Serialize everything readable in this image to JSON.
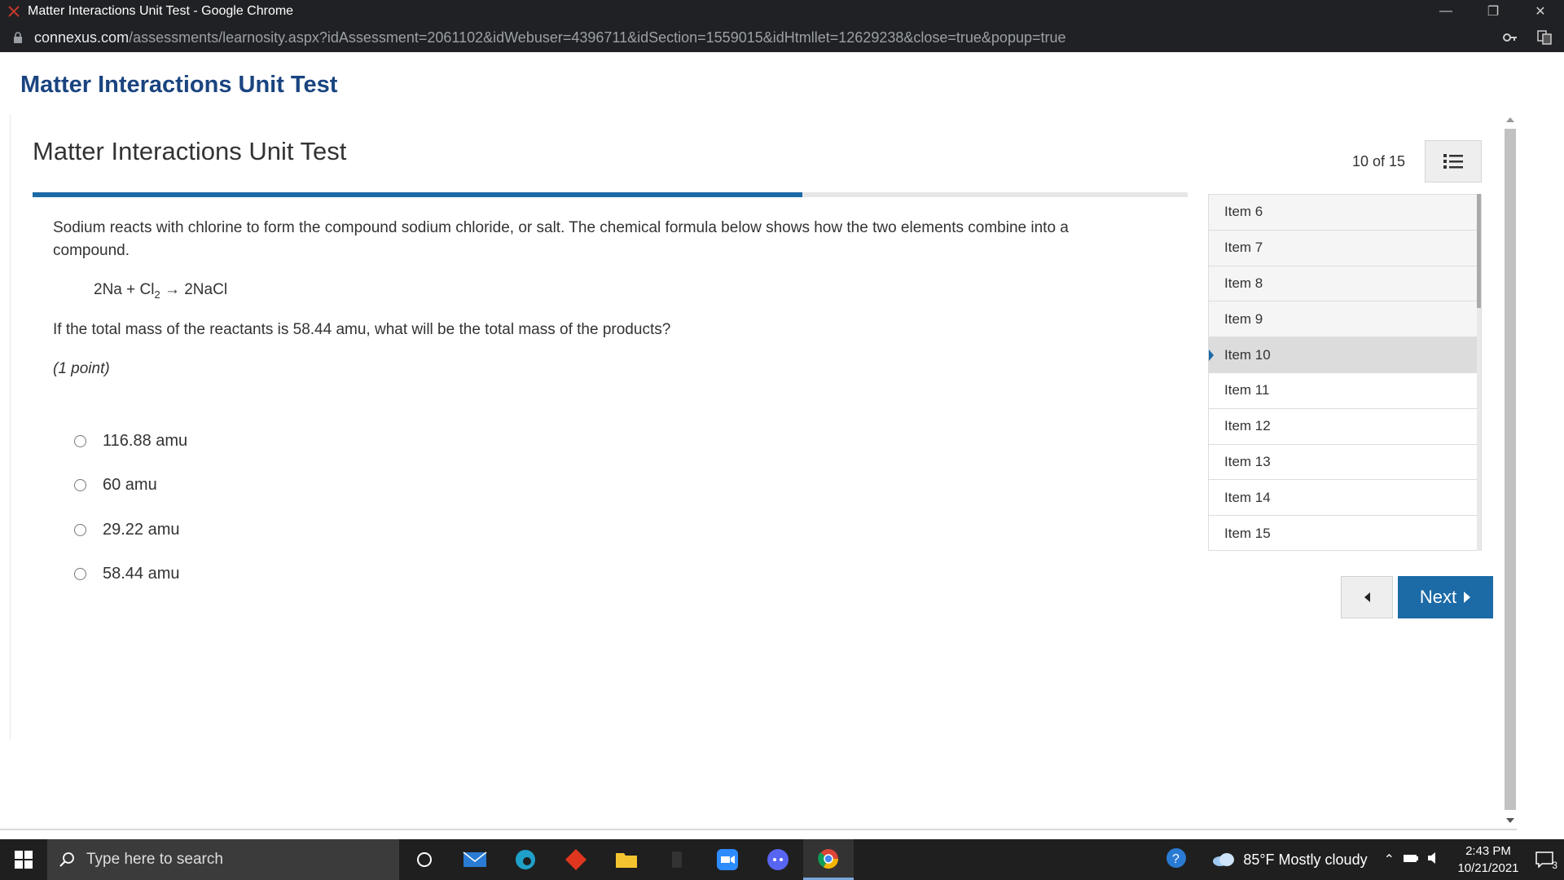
{
  "browser": {
    "window_title": "Matter Interactions Unit Test - Google Chrome",
    "url_domain": "connexus.com",
    "url_path": "/assessments/learnosity.aspx?idAssessment=2061102&idWebuser=4396711&idSection=1559015&idHtmllet=12629238&close=true&popup=true"
  },
  "page": {
    "header": "Matter Interactions Unit Test",
    "test_title": "Matter Interactions Unit Test",
    "counter": "10 of 15",
    "progress_fraction": 0.6667
  },
  "question": {
    "stem": "Sodium reacts with chlorine to form the compound sodium chloride, or salt. The chemical formula below shows how the two elements combine into a compound.",
    "formula_left": "2Na + Cl",
    "formula_sub": "2",
    "formula_right": " → 2NaCl",
    "prompt": "If the total mass of the reactants is 58.44 amu, what will be the total mass of the products?",
    "points": "(1 point)",
    "choices": [
      "116.88 amu",
      "60 amu",
      "29.22 amu",
      "58.44 amu"
    ]
  },
  "item_list": {
    "items": [
      "Item 6",
      "Item 7",
      "Item 8",
      "Item 9",
      "Item 10",
      "Item 11",
      "Item 12",
      "Item 13",
      "Item 14",
      "Item 15"
    ],
    "current": "Item 10"
  },
  "nav": {
    "next_label": "Next"
  },
  "taskbar": {
    "search_placeholder": "Type here to search",
    "weather": "85°F  Mostly cloudy",
    "time": "2:43 PM",
    "date": "10/21/2021",
    "notification_count": "3"
  },
  "colors": {
    "accent": "#1c6aa6",
    "header_blue": "#1a4480"
  }
}
